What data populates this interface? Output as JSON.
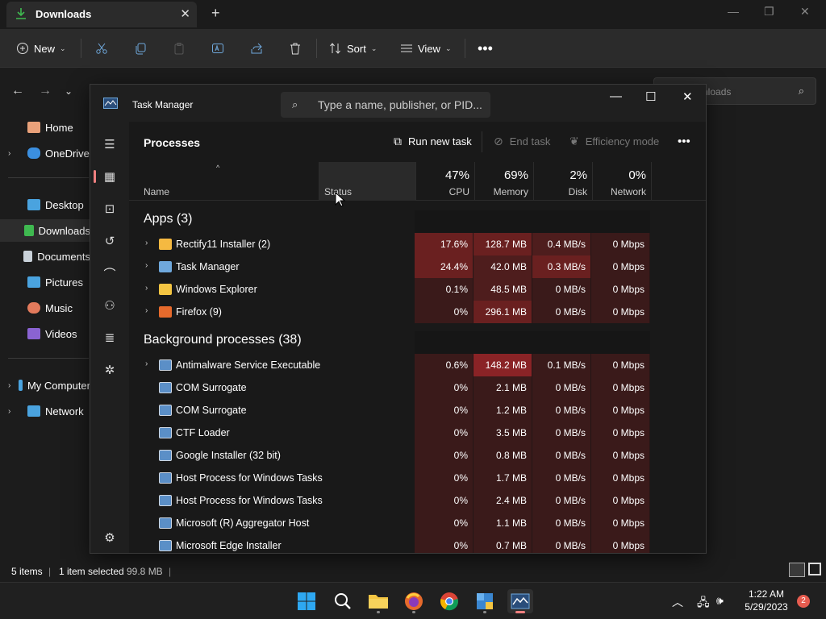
{
  "explorer": {
    "tab_title": "Downloads",
    "toolbar": {
      "new_label": "New",
      "sort_label": "Sort",
      "view_label": "View"
    },
    "search_placeholder": "nloads",
    "sidebar": [
      {
        "label": "Home",
        "color": "#e9a17a"
      },
      {
        "label": "OneDrive",
        "color": "#3b8fe0"
      },
      {
        "label": "Desktop",
        "color": "#4aa3df"
      },
      {
        "label": "Downloads",
        "color": "#3fb950"
      },
      {
        "label": "Documents",
        "color": "#c9d1d9"
      },
      {
        "label": "Pictures",
        "color": "#4aa3df"
      },
      {
        "label": "Music",
        "color": "#e27a5c"
      },
      {
        "label": "Videos",
        "color": "#8a63d2"
      },
      {
        "label": "My Computer",
        "color": "#4aa3df"
      },
      {
        "label": "Network",
        "color": "#4aa3df"
      }
    ],
    "status": {
      "items": "5 items",
      "selected": "1 item selected",
      "size": "99.8 MB"
    }
  },
  "task_manager": {
    "title": "Task Manager",
    "search_placeholder": "Type a name, publisher, or PID...",
    "pane_title": "Processes",
    "commands": {
      "run_new_task": "Run new task",
      "end_task": "End task",
      "efficiency_mode": "Efficiency mode"
    },
    "columns": {
      "name": "Name",
      "status": "Status",
      "cpu_pct": "47%",
      "cpu": "CPU",
      "mem_pct": "69%",
      "memory": "Memory",
      "disk_pct": "2%",
      "disk": "Disk",
      "net_pct": "0%",
      "network": "Network"
    },
    "groups": {
      "apps": "Apps (3)",
      "background": "Background processes (38)"
    },
    "apps": [
      {
        "name": "Rectify11 Installer (2)",
        "cpu": "17.6%",
        "memory": "128.7 MB",
        "disk": "0.4 MB/s",
        "network": "0 Mbps",
        "icon_color": "#f5b941",
        "cpu_heat": 3,
        "mem_heat": 3,
        "disk_heat": 2
      },
      {
        "name": "Task Manager",
        "cpu": "24.4%",
        "memory": "42.0 MB",
        "disk": "0.3 MB/s",
        "network": "0 Mbps",
        "icon_color": "#6fa8dc",
        "cpu_heat": 3,
        "mem_heat": 2,
        "disk_heat": 3
      },
      {
        "name": "Windows Explorer",
        "cpu": "0.1%",
        "memory": "48.5 MB",
        "disk": "0 MB/s",
        "network": "0 Mbps",
        "icon_color": "#f4c542",
        "cpu_heat": 1,
        "mem_heat": 2,
        "disk_heat": 1
      },
      {
        "name": "Firefox (9)",
        "cpu": "0%",
        "memory": "296.1 MB",
        "disk": "0 MB/s",
        "network": "0 Mbps",
        "icon_color": "#e66a2c",
        "cpu_heat": 1,
        "mem_heat": 3,
        "disk_heat": 1
      }
    ],
    "background": [
      {
        "name": "Antimalware Service Executable",
        "cpu": "0.6%",
        "memory": "148.2 MB",
        "disk": "0.1 MB/s",
        "network": "0 Mbps",
        "expandable": true,
        "mem_heat": 4
      },
      {
        "name": "COM Surrogate",
        "cpu": "0%",
        "memory": "2.1 MB",
        "disk": "0 MB/s",
        "network": "0 Mbps",
        "expandable": false,
        "mem_heat": 1
      },
      {
        "name": "COM Surrogate",
        "cpu": "0%",
        "memory": "1.2 MB",
        "disk": "0 MB/s",
        "network": "0 Mbps",
        "expandable": false,
        "mem_heat": 1
      },
      {
        "name": "CTF Loader",
        "cpu": "0%",
        "memory": "3.5 MB",
        "disk": "0 MB/s",
        "network": "0 Mbps",
        "expandable": false,
        "mem_heat": 1
      },
      {
        "name": "Google Installer (32 bit)",
        "cpu": "0%",
        "memory": "0.8 MB",
        "disk": "0 MB/s",
        "network": "0 Mbps",
        "expandable": false,
        "mem_heat": 1
      },
      {
        "name": "Host Process for Windows Tasks",
        "cpu": "0%",
        "memory": "1.7 MB",
        "disk": "0 MB/s",
        "network": "0 Mbps",
        "expandable": false,
        "mem_heat": 1
      },
      {
        "name": "Host Process for Windows Tasks",
        "cpu": "0%",
        "memory": "2.4 MB",
        "disk": "0 MB/s",
        "network": "0 Mbps",
        "expandable": false,
        "mem_heat": 1
      },
      {
        "name": "Microsoft (R) Aggregator Host",
        "cpu": "0%",
        "memory": "1.1 MB",
        "disk": "0 MB/s",
        "network": "0 Mbps",
        "expandable": false,
        "mem_heat": 1
      },
      {
        "name": "Microsoft Edge Installer",
        "cpu": "0%",
        "memory": "0.7 MB",
        "disk": "0 MB/s",
        "network": "0 Mbps",
        "expandable": false,
        "mem_heat": 1
      }
    ]
  },
  "taskbar": {
    "time": "1:22 AM",
    "date": "5/29/2023",
    "notification_count": "2"
  },
  "heat_colors": [
    "#1f1515",
    "#3a1a1a",
    "#4e1d1d",
    "#6a2020",
    "#8a2326"
  ]
}
